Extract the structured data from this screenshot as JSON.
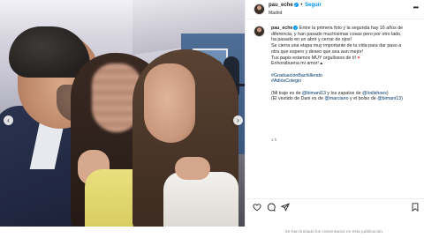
{
  "header": {
    "username": "pau_eche",
    "separator": "•",
    "follow_label": "Seguir",
    "location": "Madrid",
    "more_icon": "more-horizontal-icon"
  },
  "caption": {
    "username": "pau_eche",
    "lines": [
      "Entre la primera foto y la segunda hay 16 años de",
      "diferencia, y han pasado muchísimas cosas pero por otro lado,",
      "ha pasado en un abrir y cerrar de ojos!",
      "Se cierra una etapa muy importante de tu vida para dar paso a",
      "otra que espero y deseo que sea aun mejor!",
      "Tus papis estamos MUY orgullosos de ti!",
      "Enhorabuena mi amor!"
    ],
    "hashtags": [
      "#GraduaciónBachillerato",
      "#AdiósColegio"
    ],
    "credits_1_prefix": "(Mi traje es de ",
    "credits_1_tag1": "@bimani13",
    "credits_1_mid": " y los zapatos de ",
    "credits_1_tag2": "@lodishoes",
    "credits_1_suffix": ")",
    "credits_2_prefix": "(El vestido de Dani es de ",
    "credits_2_tag1": "@marciano",
    "credits_2_mid": " y el bolso de ",
    "credits_2_tag2": "@bimani13",
    "credits_2_suffix": ")",
    "time": "1 h"
  },
  "photo": {
    "prev_label": "‹",
    "next_label": "›"
  },
  "actions": {
    "like_icon": "heart-icon",
    "comment_icon": "comment-icon",
    "share_icon": "share-icon",
    "save_icon": "bookmark-icon"
  },
  "footer": {
    "comments_limited": "Se han limitado los comentarios en esta publicación."
  },
  "colors": {
    "link": "#00376b",
    "accent": "#0095f6",
    "heart": "#ed4956"
  }
}
